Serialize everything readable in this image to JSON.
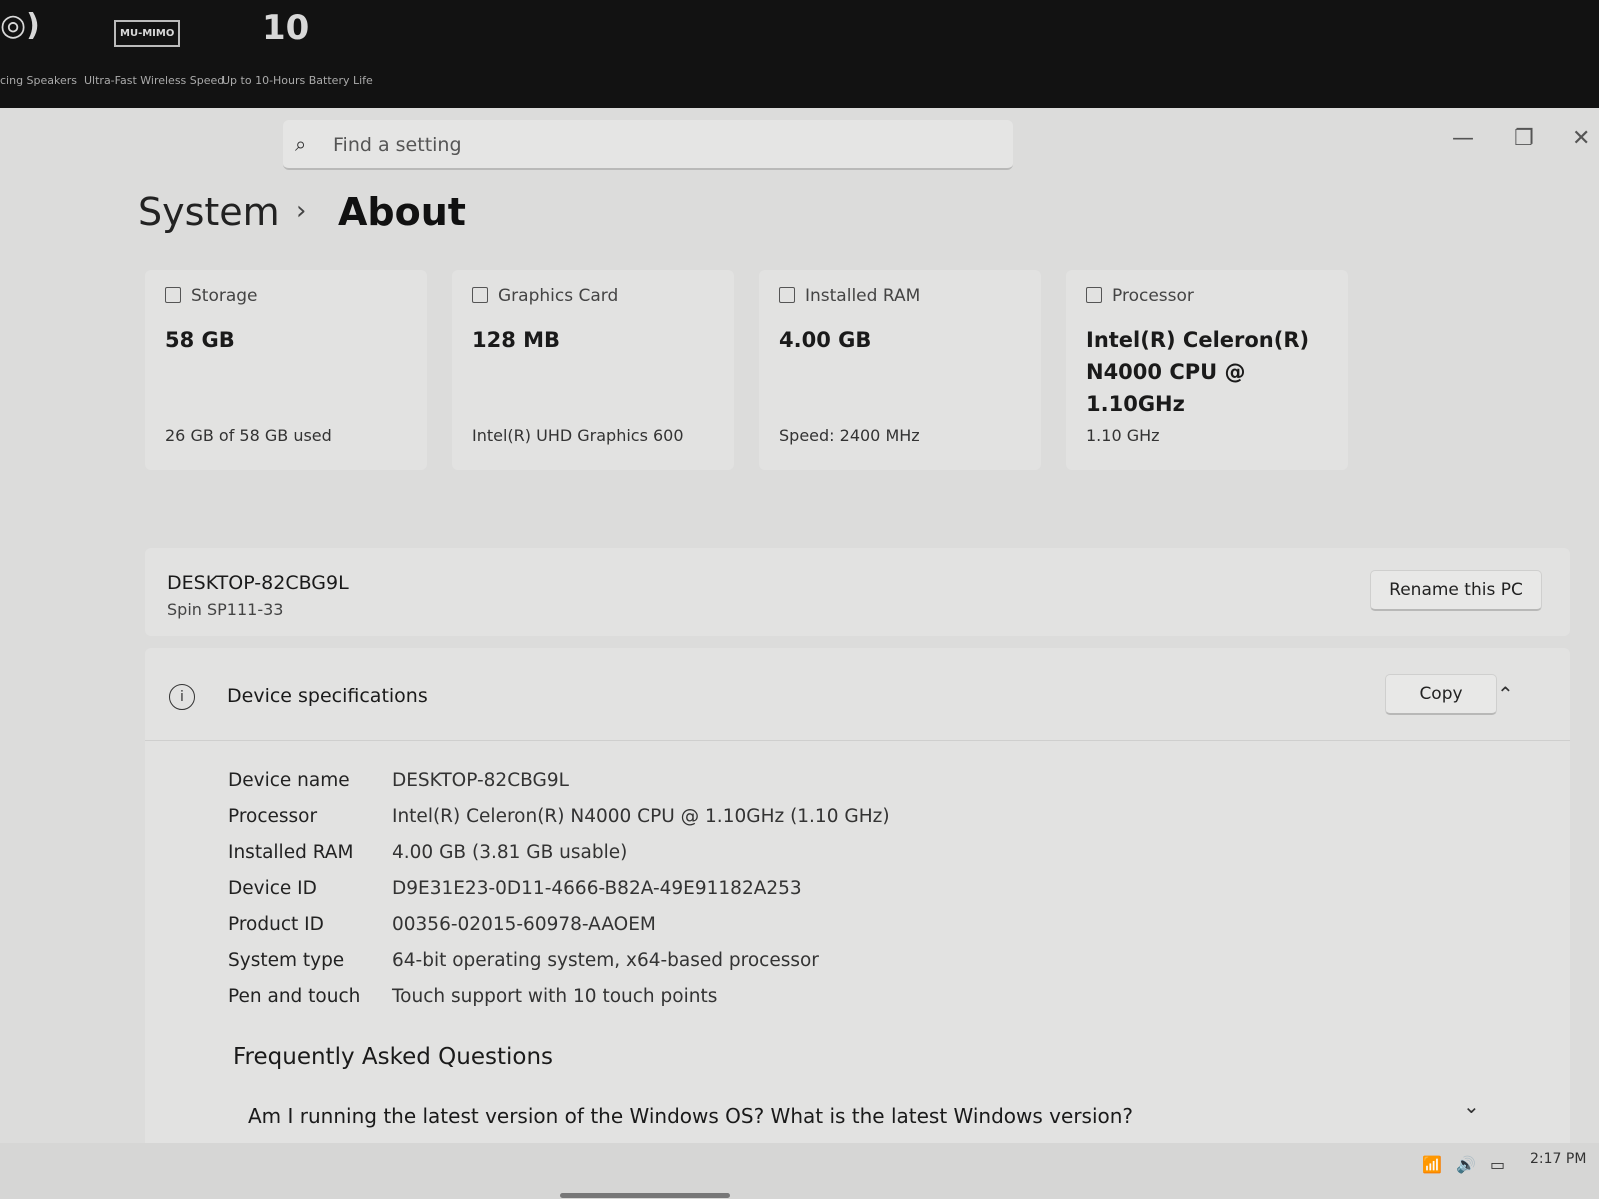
{
  "sticker": {
    "features": [
      {
        "icon": "speaker-icon",
        "glyph": "◎)",
        "caption": "cing Speakers"
      },
      {
        "icon": "laptop-icon",
        "glyph": "MU-MIMO",
        "caption": "Ultra-Fast Wireless Speed"
      },
      {
        "icon": "battery-hours-icon",
        "glyph": "10",
        "caption": "Up to 10-Hours Battery Life"
      }
    ]
  },
  "search": {
    "placeholder": "Find a setting"
  },
  "window": {
    "minimize": "—",
    "restore": "❐",
    "close": "✕"
  },
  "breadcrumb": {
    "section": "System",
    "separator": "›",
    "page": "About"
  },
  "cards": [
    {
      "label": "Storage",
      "icon": "storage-icon",
      "value": "58 GB",
      "sub": "26 GB of 58 GB used"
    },
    {
      "label": "Graphics Card",
      "icon": "graphics-card-icon",
      "value": "128 MB",
      "sub": "Intel(R) UHD Graphics 600"
    },
    {
      "label": "Installed RAM",
      "icon": "ram-icon",
      "value": "4.00 GB",
      "sub": "Speed: 2400 MHz"
    },
    {
      "label": "Processor",
      "icon": "processor-icon",
      "value": "Intel(R) Celeron(R) N4000 CPU @ 1.10GHz",
      "sub": "1.10 GHz"
    }
  ],
  "pc": {
    "name": "DESKTOP-82CBG9L",
    "model": "Spin SP111-33",
    "rename_label": "Rename this PC"
  },
  "specs": {
    "title": "Device specifications",
    "copy_label": "Copy",
    "rows": [
      {
        "label": "Device name",
        "value": "DESKTOP-82CBG9L"
      },
      {
        "label": "Processor",
        "value": "Intel(R) Celeron(R) N4000 CPU @ 1.10GHz (1.10 GHz)"
      },
      {
        "label": "Installed RAM",
        "value": "4.00 GB (3.81 GB usable)"
      },
      {
        "label": "Device ID",
        "value": "D9E31E23-0D11-4666-B82A-49E91182A253"
      },
      {
        "label": "Product ID",
        "value": "00356-02015-60978-AAOEM"
      },
      {
        "label": "System type",
        "value": "64-bit operating system, x64-based processor"
      },
      {
        "label": "Pen and touch",
        "value": "Touch support with 10 touch points"
      }
    ]
  },
  "faq": {
    "heading": "Frequently Asked Questions",
    "question": "Am I running the latest version of the Windows OS? What is the latest Windows version?"
  },
  "taskbar": {
    "time": "2:17 PM",
    "tray_icons": [
      "wifi-icon",
      "volume-icon",
      "battery-icon"
    ]
  }
}
